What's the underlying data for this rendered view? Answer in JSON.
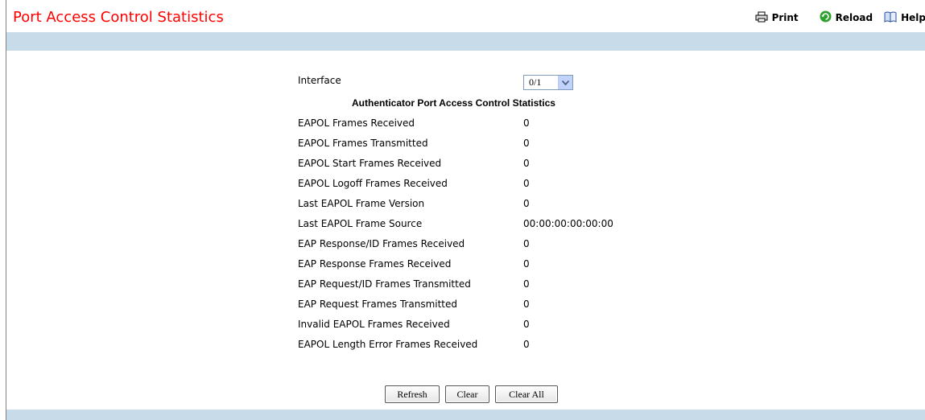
{
  "header": {
    "title": "Port Access Control Statistics",
    "print_label": "Print",
    "reload_label": "Reload",
    "help_label": "Help"
  },
  "form": {
    "interface_label": "Interface",
    "interface_value": "0/1",
    "section_title": "Authenticator Port Access Control Statistics"
  },
  "stats": [
    {
      "label": "EAPOL Frames Received",
      "value": "0"
    },
    {
      "label": "EAPOL Frames Transmitted",
      "value": "0"
    },
    {
      "label": "EAPOL Start Frames Received",
      "value": "0"
    },
    {
      "label": "EAPOL Logoff Frames Received",
      "value": "0"
    },
    {
      "label": "Last EAPOL Frame Version",
      "value": "0"
    },
    {
      "label": "Last EAPOL Frame Source",
      "value": "00:00:00:00:00:00"
    },
    {
      "label": "EAP Response/ID Frames Received",
      "value": "0"
    },
    {
      "label": "EAP Response Frames Received",
      "value": "0"
    },
    {
      "label": "EAP Request/ID Frames Transmitted",
      "value": "0"
    },
    {
      "label": "EAP Request Frames Transmitted",
      "value": "0"
    },
    {
      "label": "Invalid EAPOL Frames Received",
      "value": "0"
    },
    {
      "label": "EAPOL Length Error Frames Received",
      "value": "0"
    }
  ],
  "buttons": {
    "refresh": "Refresh",
    "clear": "Clear",
    "clear_all": "Clear All"
  },
  "colors": {
    "title": "#ff0000",
    "band": "#c8dbe8"
  },
  "icons": {
    "print": "printer-icon",
    "reload": "reload-icon",
    "help": "help-book-icon"
  }
}
